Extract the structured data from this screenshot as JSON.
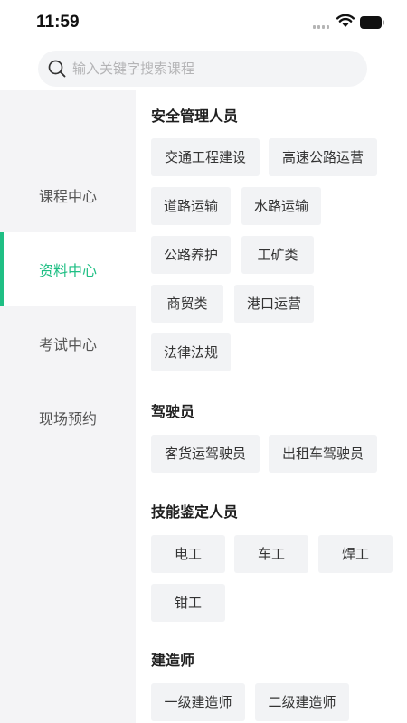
{
  "status": {
    "time": "11:59"
  },
  "search": {
    "placeholder": "输入关键字搜索课程"
  },
  "sidebar": {
    "items": [
      {
        "label": "课程中心"
      },
      {
        "label": "资料中心"
      },
      {
        "label": "考试中心"
      },
      {
        "label": "现场预约"
      }
    ],
    "active_index": 1
  },
  "colors": {
    "accent": "#1fbf84",
    "sidebar_bg": "#f4f4f6",
    "chip_bg": "#f2f3f5"
  },
  "sections": [
    {
      "title": "安全管理人员",
      "tags": [
        "交通工程建设",
        "高速公路运营",
        "道路运输",
        "水路运输",
        "公路养护",
        "工矿类",
        "商贸类",
        "港口运营",
        "法律法规"
      ]
    },
    {
      "title": "驾驶员",
      "tags": [
        "客货运驾驶员",
        "出租车驾驶员"
      ]
    },
    {
      "title": "技能鉴定人员",
      "tags": [
        "电工",
        "车工",
        "焊工",
        "钳工"
      ]
    },
    {
      "title": "建造师",
      "tags": [
        "一级建造师",
        "二级建造师"
      ]
    }
  ]
}
